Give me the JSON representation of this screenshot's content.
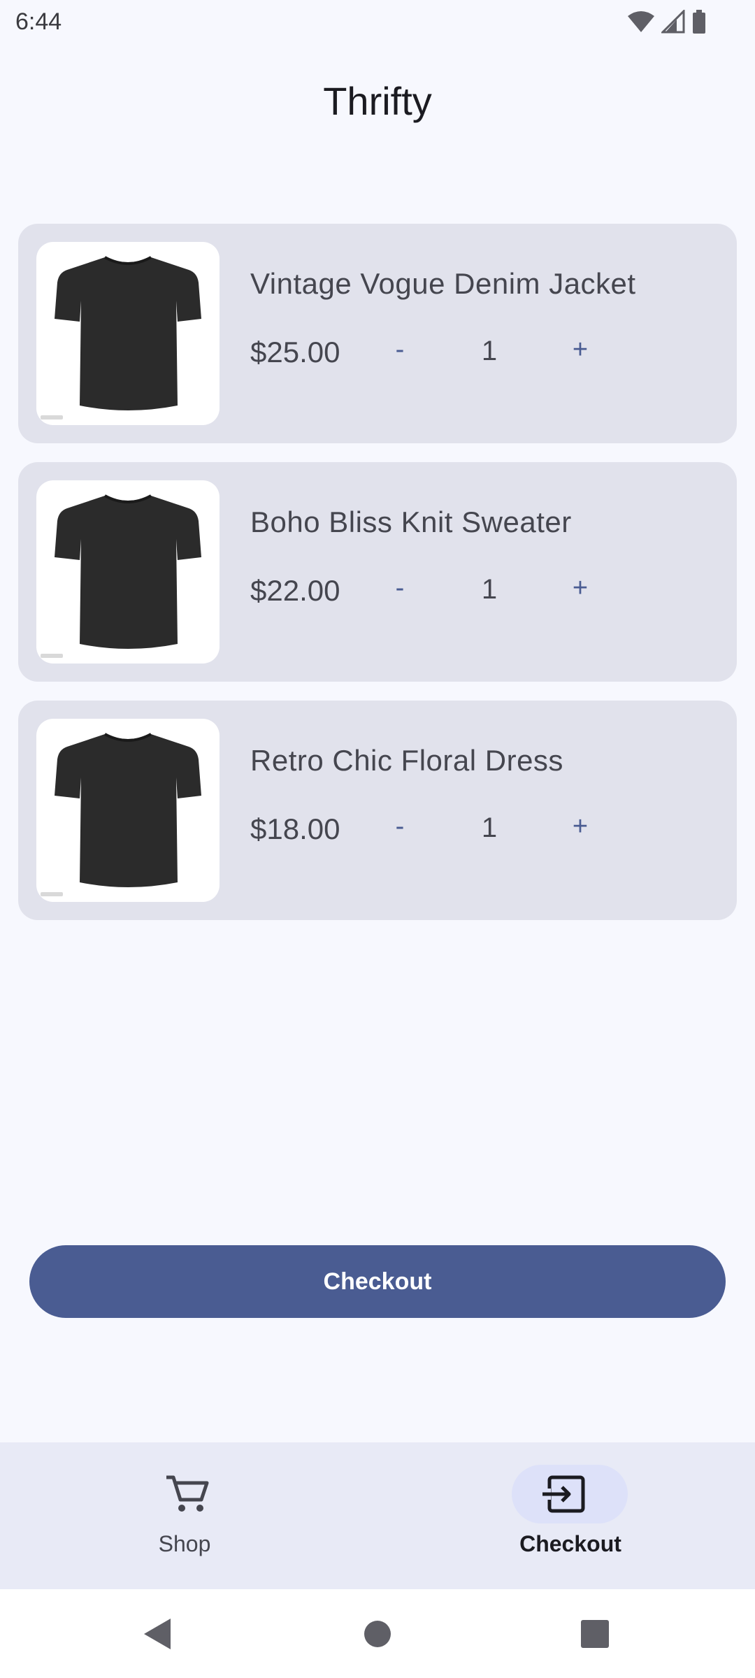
{
  "status_bar": {
    "time": "6:44"
  },
  "app": {
    "title": "Thrifty"
  },
  "cart": {
    "items": [
      {
        "name": "Vintage Vogue Denim Jacket",
        "price": "$25.00",
        "quantity": "1",
        "minus": "-",
        "plus": "+"
      },
      {
        "name": "Boho Bliss Knit Sweater",
        "price": "$22.00",
        "quantity": "1",
        "minus": "-",
        "plus": "+"
      },
      {
        "name": "Retro Chic Floral Dress",
        "price": "$18.00",
        "quantity": "1",
        "minus": "-",
        "plus": "+"
      }
    ]
  },
  "checkout_button": {
    "label": "Checkout"
  },
  "bottom_nav": {
    "items": [
      {
        "label": "Shop",
        "icon": "cart-icon",
        "selected": false
      },
      {
        "label": "Checkout",
        "icon": "exit-to-app-icon",
        "selected": true
      }
    ]
  },
  "colors": {
    "primary": "#4a5c92",
    "card_background": "#e1e2ec",
    "page_background": "#f7f8fe",
    "nav_background": "#e8eaf6",
    "nav_indicator": "#dde1f9"
  }
}
